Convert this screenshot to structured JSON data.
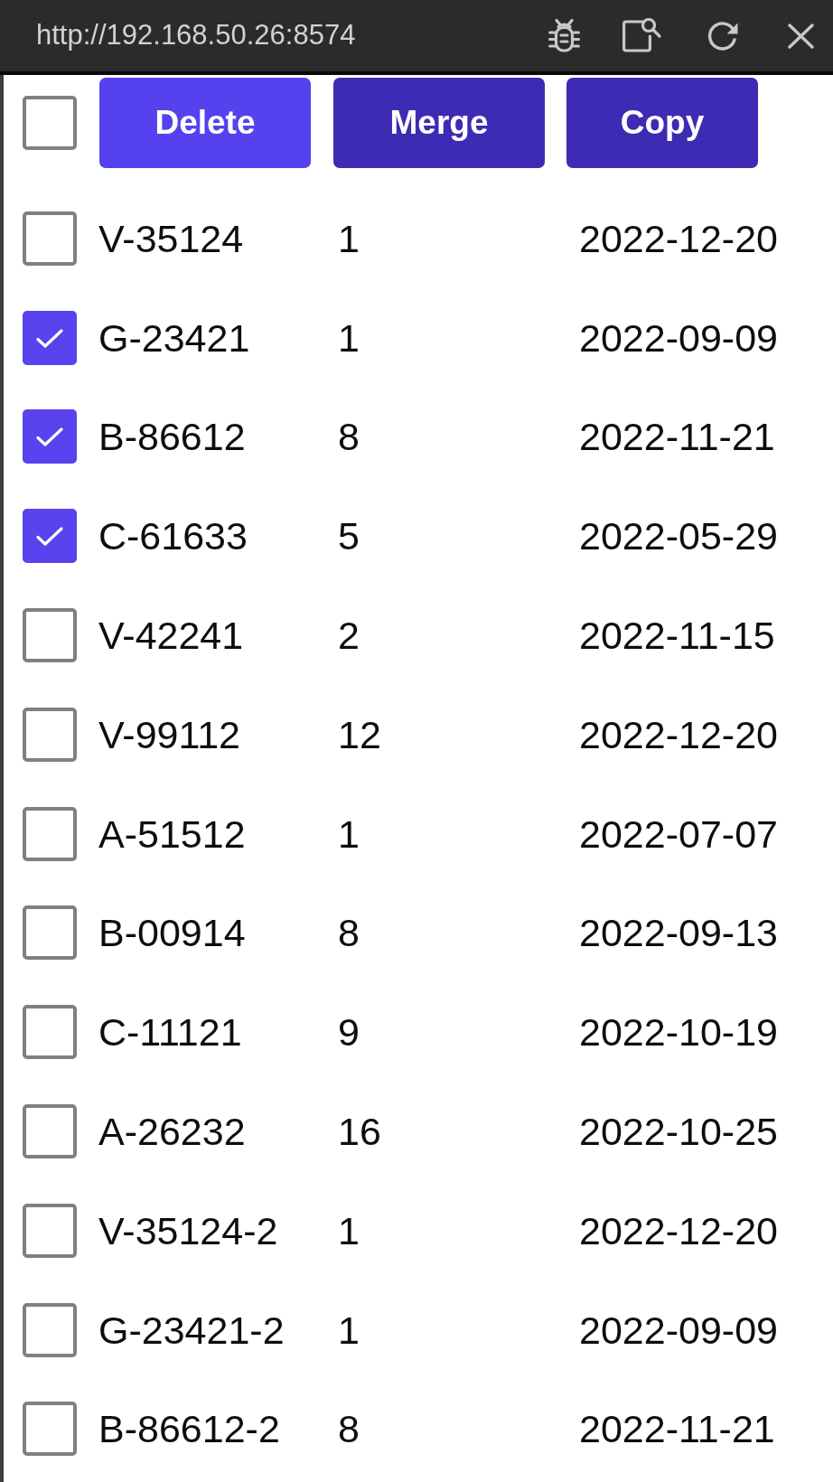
{
  "window": {
    "title": "http://192.168.50.26:8574"
  },
  "toolbar": {
    "select_all": {
      "checked": false
    },
    "buttons": [
      {
        "label": "Delete",
        "hovered": true
      },
      {
        "label": "Merge",
        "hovered": false
      },
      {
        "label": "Copy",
        "hovered": false
      }
    ]
  },
  "rows": [
    {
      "checked": false,
      "cells": [
        "V-35124",
        "1",
        "2022-12-20"
      ]
    },
    {
      "checked": true,
      "cells": [
        "G-23421",
        "1",
        "2022-09-09"
      ]
    },
    {
      "checked": true,
      "cells": [
        "B-86612",
        "8",
        "2022-11-21"
      ]
    },
    {
      "checked": true,
      "cells": [
        "C-61633",
        "5",
        "2022-05-29"
      ]
    },
    {
      "checked": false,
      "cells": [
        "V-42241",
        "2",
        "2022-11-15"
      ]
    },
    {
      "checked": false,
      "cells": [
        "V-99112",
        "12",
        "2022-12-20"
      ]
    },
    {
      "checked": false,
      "cells": [
        "A-51512",
        "1",
        "2022-07-07"
      ]
    },
    {
      "checked": false,
      "cells": [
        "B-00914",
        "8",
        "2022-09-13"
      ]
    },
    {
      "checked": false,
      "cells": [
        "C-11121",
        "9",
        "2022-10-19"
      ]
    },
    {
      "checked": false,
      "cells": [
        "A-26232",
        "16",
        "2022-10-25"
      ]
    },
    {
      "checked": false,
      "cells": [
        "V-35124-2",
        "1",
        "2022-12-20"
      ]
    },
    {
      "checked": false,
      "cells": [
        "G-23421-2",
        "1",
        "2022-09-09"
      ]
    },
    {
      "checked": false,
      "cells": [
        "B-86612-2",
        "8",
        "2022-11-21"
      ]
    }
  ]
}
